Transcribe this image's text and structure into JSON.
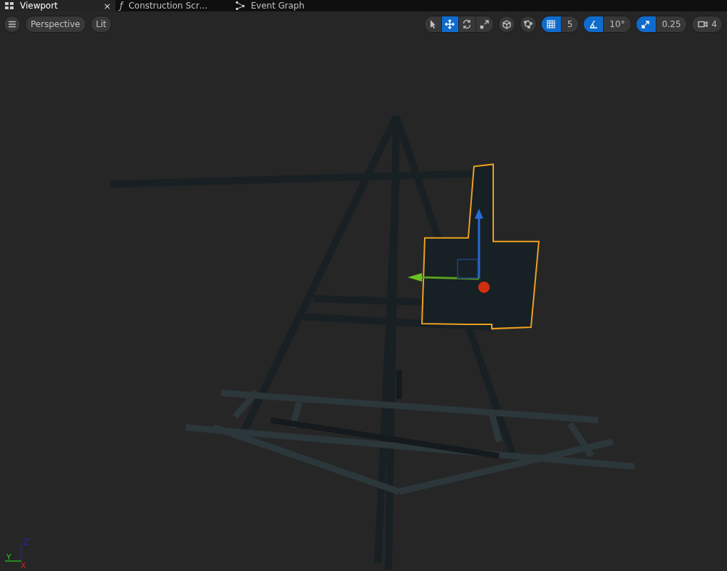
{
  "tabs": [
    {
      "kind": "viewport",
      "label": "Viewport",
      "selected": true,
      "closable": true
    },
    {
      "kind": "function",
      "label": "Construction Scr…",
      "selected": false,
      "closable": false
    },
    {
      "kind": "graph",
      "label": "Event Graph",
      "selected": false,
      "closable": false
    }
  ],
  "close_glyph": "×",
  "function_glyph": "ƒ",
  "view_buttons": [
    {
      "label": "Perspective"
    },
    {
      "label": "Lit"
    }
  ],
  "transform_tools": [
    {
      "kind": "select",
      "selected": false
    },
    {
      "kind": "translate",
      "selected": true
    },
    {
      "kind": "rotate",
      "selected": false
    },
    {
      "kind": "scale",
      "selected": false
    }
  ],
  "extra_tools": [
    {
      "kind": "space"
    },
    {
      "kind": "surface"
    }
  ],
  "snaps": [
    {
      "kind": "grid",
      "on": true,
      "value": "5"
    },
    {
      "kind": "angle",
      "on": true,
      "value": "10°"
    },
    {
      "kind": "scale",
      "on": true,
      "value": "0.25"
    }
  ],
  "camera_speed": "4",
  "axes": [
    {
      "kind": "z",
      "label": "Z"
    },
    {
      "kind": "y",
      "label": "Y"
    },
    {
      "kind": "x",
      "label": "X"
    }
  ]
}
